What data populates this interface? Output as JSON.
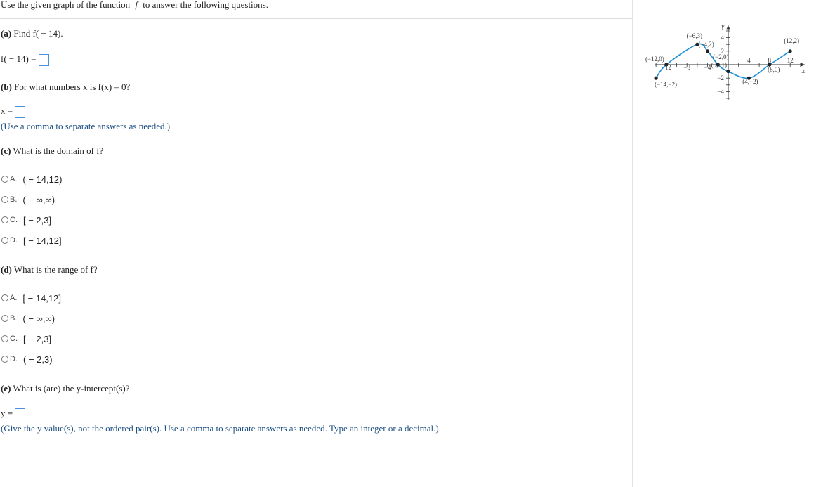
{
  "instruction": {
    "prefix": "Use the given graph of the function",
    "var": "f",
    "suffix": "to answer the following questions."
  },
  "qa": {
    "label": "(a)",
    "text": "Find f( − 14).",
    "answer_prefix": "f( − 14) ="
  },
  "qb": {
    "label": "(b)",
    "text": "For what numbers x is f(x) = 0?",
    "answer_prefix": "x =",
    "hint": "(Use a comma to separate answers as needed.)"
  },
  "qc": {
    "label": "(c)",
    "text": "What is the domain of f?",
    "options": [
      {
        "letter": "A.",
        "value": "( − 14,12)"
      },
      {
        "letter": "B.",
        "value": "( − ∞,∞)"
      },
      {
        "letter": "C.",
        "value": "[ − 2,3]"
      },
      {
        "letter": "D.",
        "value": "[ − 14,12]"
      }
    ]
  },
  "qd": {
    "label": "(d)",
    "text": "What is the range of f?",
    "options": [
      {
        "letter": "A.",
        "value": "[ − 14,12]"
      },
      {
        "letter": "B.",
        "value": "( − ∞,∞)"
      },
      {
        "letter": "C.",
        "value": "[ − 2,3]"
      },
      {
        "letter": "D.",
        "value": "( − 2,3)"
      }
    ]
  },
  "qe": {
    "label": "(e)",
    "text": "What is (are) the y-intercept(s)?",
    "answer_prefix": "y =",
    "hint": "(Give the y value(s), not the ordered pair(s). Use a comma to separate answers as needed. Type an integer or a decimal.)"
  },
  "chart_data": {
    "type": "line",
    "x_axis_label": "x",
    "y_axis_label": "y",
    "xlim": [
      -14,
      14
    ],
    "ylim": [
      -5,
      5
    ],
    "x_ticks": [
      -12,
      -8,
      -4,
      4,
      8,
      12
    ],
    "x_tick_labels": [
      "−12",
      "−8",
      "−4",
      "4",
      "8",
      "12"
    ],
    "y_ticks": [
      4,
      2,
      -2,
      -4
    ],
    "y_tick_labels": [
      "4",
      "2",
      "−2",
      "−4"
    ],
    "color": "#1e90d8",
    "points": [
      {
        "x": -14,
        "y": -2,
        "label": "(−14,−2)"
      },
      {
        "x": -12,
        "y": 0,
        "label": "(−12,0)"
      },
      {
        "x": -6,
        "y": 3,
        "label": "(−6,3)"
      },
      {
        "x": -4,
        "y": 2,
        "label": "(−4,2)"
      },
      {
        "x": -2,
        "y": 0,
        "label": "(−2,0)"
      },
      {
        "x": 0,
        "y": -1,
        "label": "(0,−1)"
      },
      {
        "x": 4,
        "y": -2,
        "label": "(4,−2)"
      },
      {
        "x": 8,
        "y": 0,
        "label": "(8,0)"
      },
      {
        "x": 12,
        "y": 2,
        "label": "(12,2)"
      }
    ]
  }
}
